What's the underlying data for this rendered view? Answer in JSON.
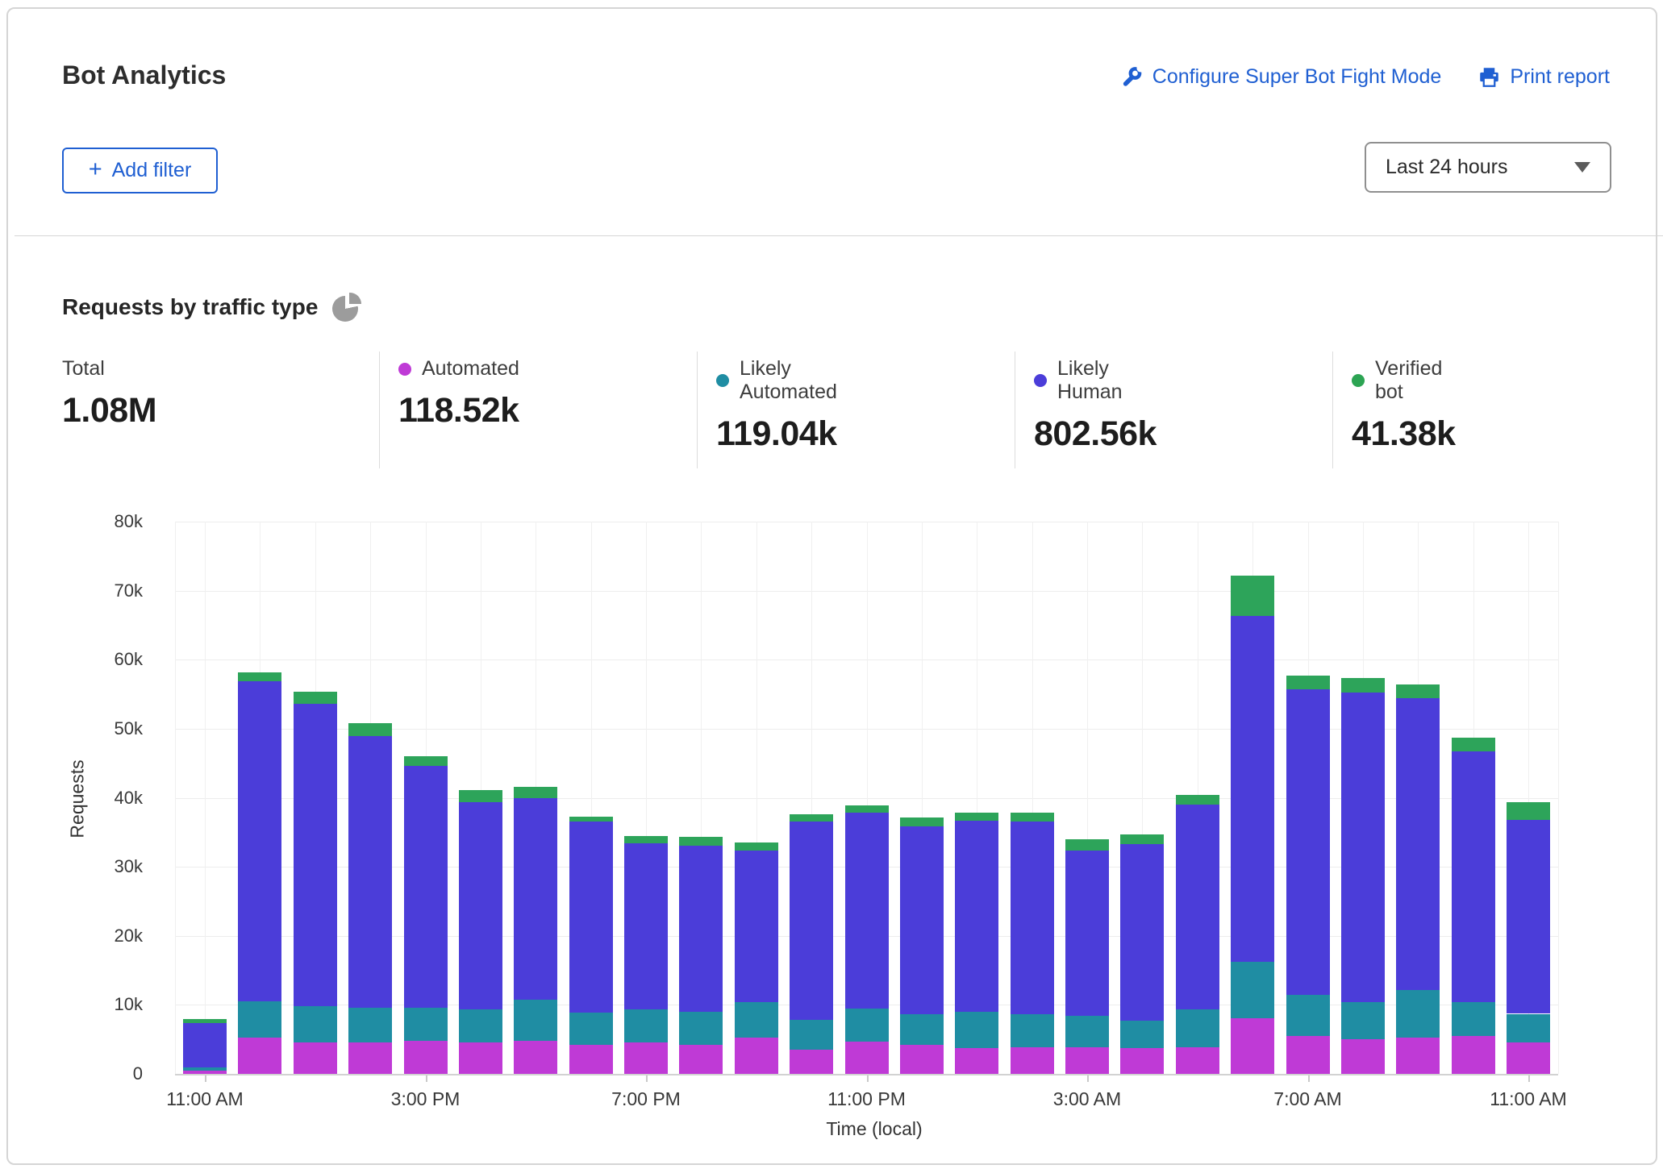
{
  "header": {
    "title": "Bot Analytics",
    "configure_link": "Configure Super Bot Fight Mode",
    "print_link": "Print report"
  },
  "filter_bar": {
    "add_filter_icon": "+",
    "add_filter_label": "Add filter",
    "time_range_value": "Last 24 hours"
  },
  "section": {
    "title": "Requests by traffic type",
    "pie_icon": "pie-chart-icon"
  },
  "stats": [
    {
      "label": "Total",
      "value": "1.08M",
      "color": null
    },
    {
      "label": "Automated",
      "value": "118.52k",
      "color": "#bf3ad6"
    },
    {
      "label": "Likely Automated",
      "value": "119.04k",
      "color": "#1f8da3"
    },
    {
      "label": "Likely Human",
      "value": "802.56k",
      "color": "#4b3dd9"
    },
    {
      "label": "Verified bot",
      "value": "41.38k",
      "color": "#2ca453"
    }
  ],
  "colors": {
    "link_blue": "#1f5fd2",
    "automated": "#bf3ad6",
    "likely_automated": "#1f8da3",
    "likely_human": "#4b3dd9",
    "verified_bot": "#2da45a",
    "grid": "#ededed",
    "axis": "#d2d2d2"
  },
  "chart_data": {
    "type": "bar",
    "stacked": true,
    "title": "Requests by traffic type",
    "xlabel": "Time (local)",
    "ylabel": "Requests",
    "units": "thousands of requests per hour",
    "ylim_k": [
      0,
      80
    ],
    "y_tick_values_k": [
      0,
      10,
      20,
      30,
      40,
      50,
      60,
      70,
      80
    ],
    "y_tick_labels": [
      "0",
      "10k",
      "20k",
      "30k",
      "40k",
      "50k",
      "60k",
      "70k",
      "80k"
    ],
    "categories": [
      "11:00 AM",
      "12:00 PM",
      "1:00 PM",
      "2:00 PM",
      "3:00 PM",
      "4:00 PM",
      "5:00 PM",
      "6:00 PM",
      "7:00 PM",
      "8:00 PM",
      "9:00 PM",
      "10:00 PM",
      "11:00 PM",
      "12:00 AM",
      "1:00 AM",
      "2:00 AM",
      "3:00 AM",
      "4:00 AM",
      "5:00 AM",
      "6:00 AM",
      "7:00 AM",
      "8:00 AM",
      "9:00 AM",
      "10:00 AM",
      "11:00 AM"
    ],
    "x_ticks": [
      {
        "index": 0,
        "label": "11:00 AM"
      },
      {
        "index": 4,
        "label": "3:00 PM"
      },
      {
        "index": 8,
        "label": "7:00 PM"
      },
      {
        "index": 12,
        "label": "11:00 PM"
      },
      {
        "index": 16,
        "label": "3:00 AM"
      },
      {
        "index": 20,
        "label": "7:00 AM"
      },
      {
        "index": 24,
        "label": "11:00 AM"
      }
    ],
    "series": [
      {
        "name": "Automated",
        "color_key": "automated",
        "values_k": [
          0.5,
          5.2,
          4.6,
          4.5,
          4.8,
          4.6,
          4.8,
          4.2,
          4.6,
          4.2,
          5.3,
          3.5,
          4.7,
          4.2,
          3.7,
          3.9,
          3.9,
          3.7,
          3.8,
          8.1,
          5.5,
          5.0,
          5.2,
          5.5,
          4.6
        ]
      },
      {
        "name": "Likely Automated",
        "color_key": "likely_automated",
        "values_k": [
          0.4,
          5.3,
          5.2,
          5.1,
          4.8,
          4.8,
          5.9,
          4.7,
          4.7,
          4.8,
          5.1,
          4.3,
          4.8,
          4.4,
          5.3,
          4.7,
          4.5,
          4.0,
          5.5,
          8.1,
          5.9,
          5.4,
          7.0,
          4.9,
          4.1
        ]
      },
      {
        "name": "Likely Human",
        "color_key": "likely_human",
        "values_k": [
          6.4,
          46.4,
          43.8,
          39.3,
          35.0,
          30.0,
          29.2,
          27.6,
          24.1,
          24.0,
          21.9,
          28.7,
          28.3,
          27.3,
          27.7,
          28.0,
          23.9,
          25.6,
          29.7,
          50.1,
          44.3,
          44.8,
          42.2,
          36.3,
          28.1
        ]
      },
      {
        "name": "Verified bot",
        "color_key": "verified_bot",
        "values_k": [
          0.6,
          1.3,
          1.7,
          1.9,
          1.4,
          1.7,
          1.7,
          0.8,
          1.0,
          1.3,
          1.2,
          1.1,
          1.1,
          1.2,
          1.1,
          1.2,
          1.7,
          1.4,
          1.4,
          5.9,
          2.0,
          2.1,
          2.0,
          2.0,
          2.6
        ]
      }
    ],
    "legend_position": "top",
    "grid": true
  }
}
